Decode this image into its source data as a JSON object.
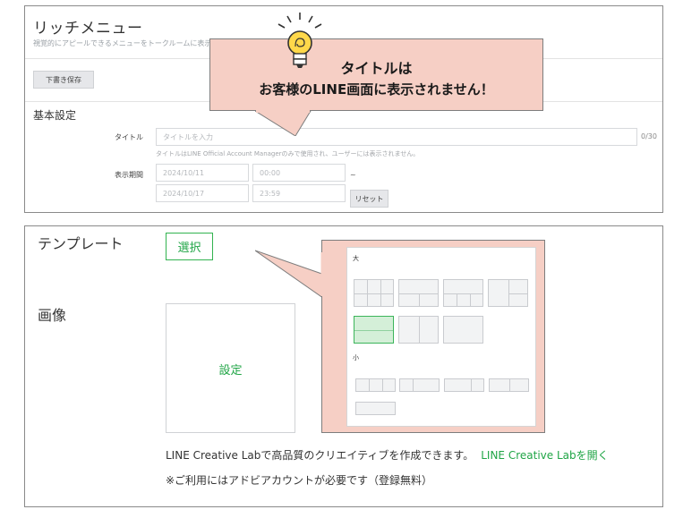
{
  "rich_menu": {
    "title": "リッチメニュー",
    "description": "視覚的にアピールできるメニューをトークルームに表示",
    "draft_save_label": "下書き保存",
    "basic_settings_heading": "基本設定",
    "title_field": {
      "label": "タイトル",
      "placeholder": "タイトルを入力",
      "counter": "0/30",
      "note": "タイトルはLINE Official Account Managerのみで使用され、ユーザーには表示されません。"
    },
    "display_period": {
      "label": "表示期間",
      "start_date": "2024/10/11",
      "start_time": "00:00",
      "separator": "~",
      "end_date": "2024/10/17",
      "end_time": "23:59",
      "reset_label": "リセット"
    }
  },
  "callout": {
    "line1": "タイトルは",
    "line2": "お客様のLINE画面に表示されません！",
    "icon": "lightbulb-icon"
  },
  "template_section": {
    "heading": "テンプレート",
    "select_label": "選択",
    "image_heading": "画像",
    "image_set_label": "設定",
    "creative_text": "LINE Creative Labで高品質のクリエイティブを作成できます。",
    "creative_link": "LINE Creative Labを開く",
    "account_note": "※ご利用にはアドビアカウントが必要です（登録無料）"
  },
  "template_preview": {
    "large_heading": "大",
    "small_heading": "小"
  },
  "colors": {
    "accent_green": "#20a546",
    "callout_pink": "#f6cfc5"
  }
}
